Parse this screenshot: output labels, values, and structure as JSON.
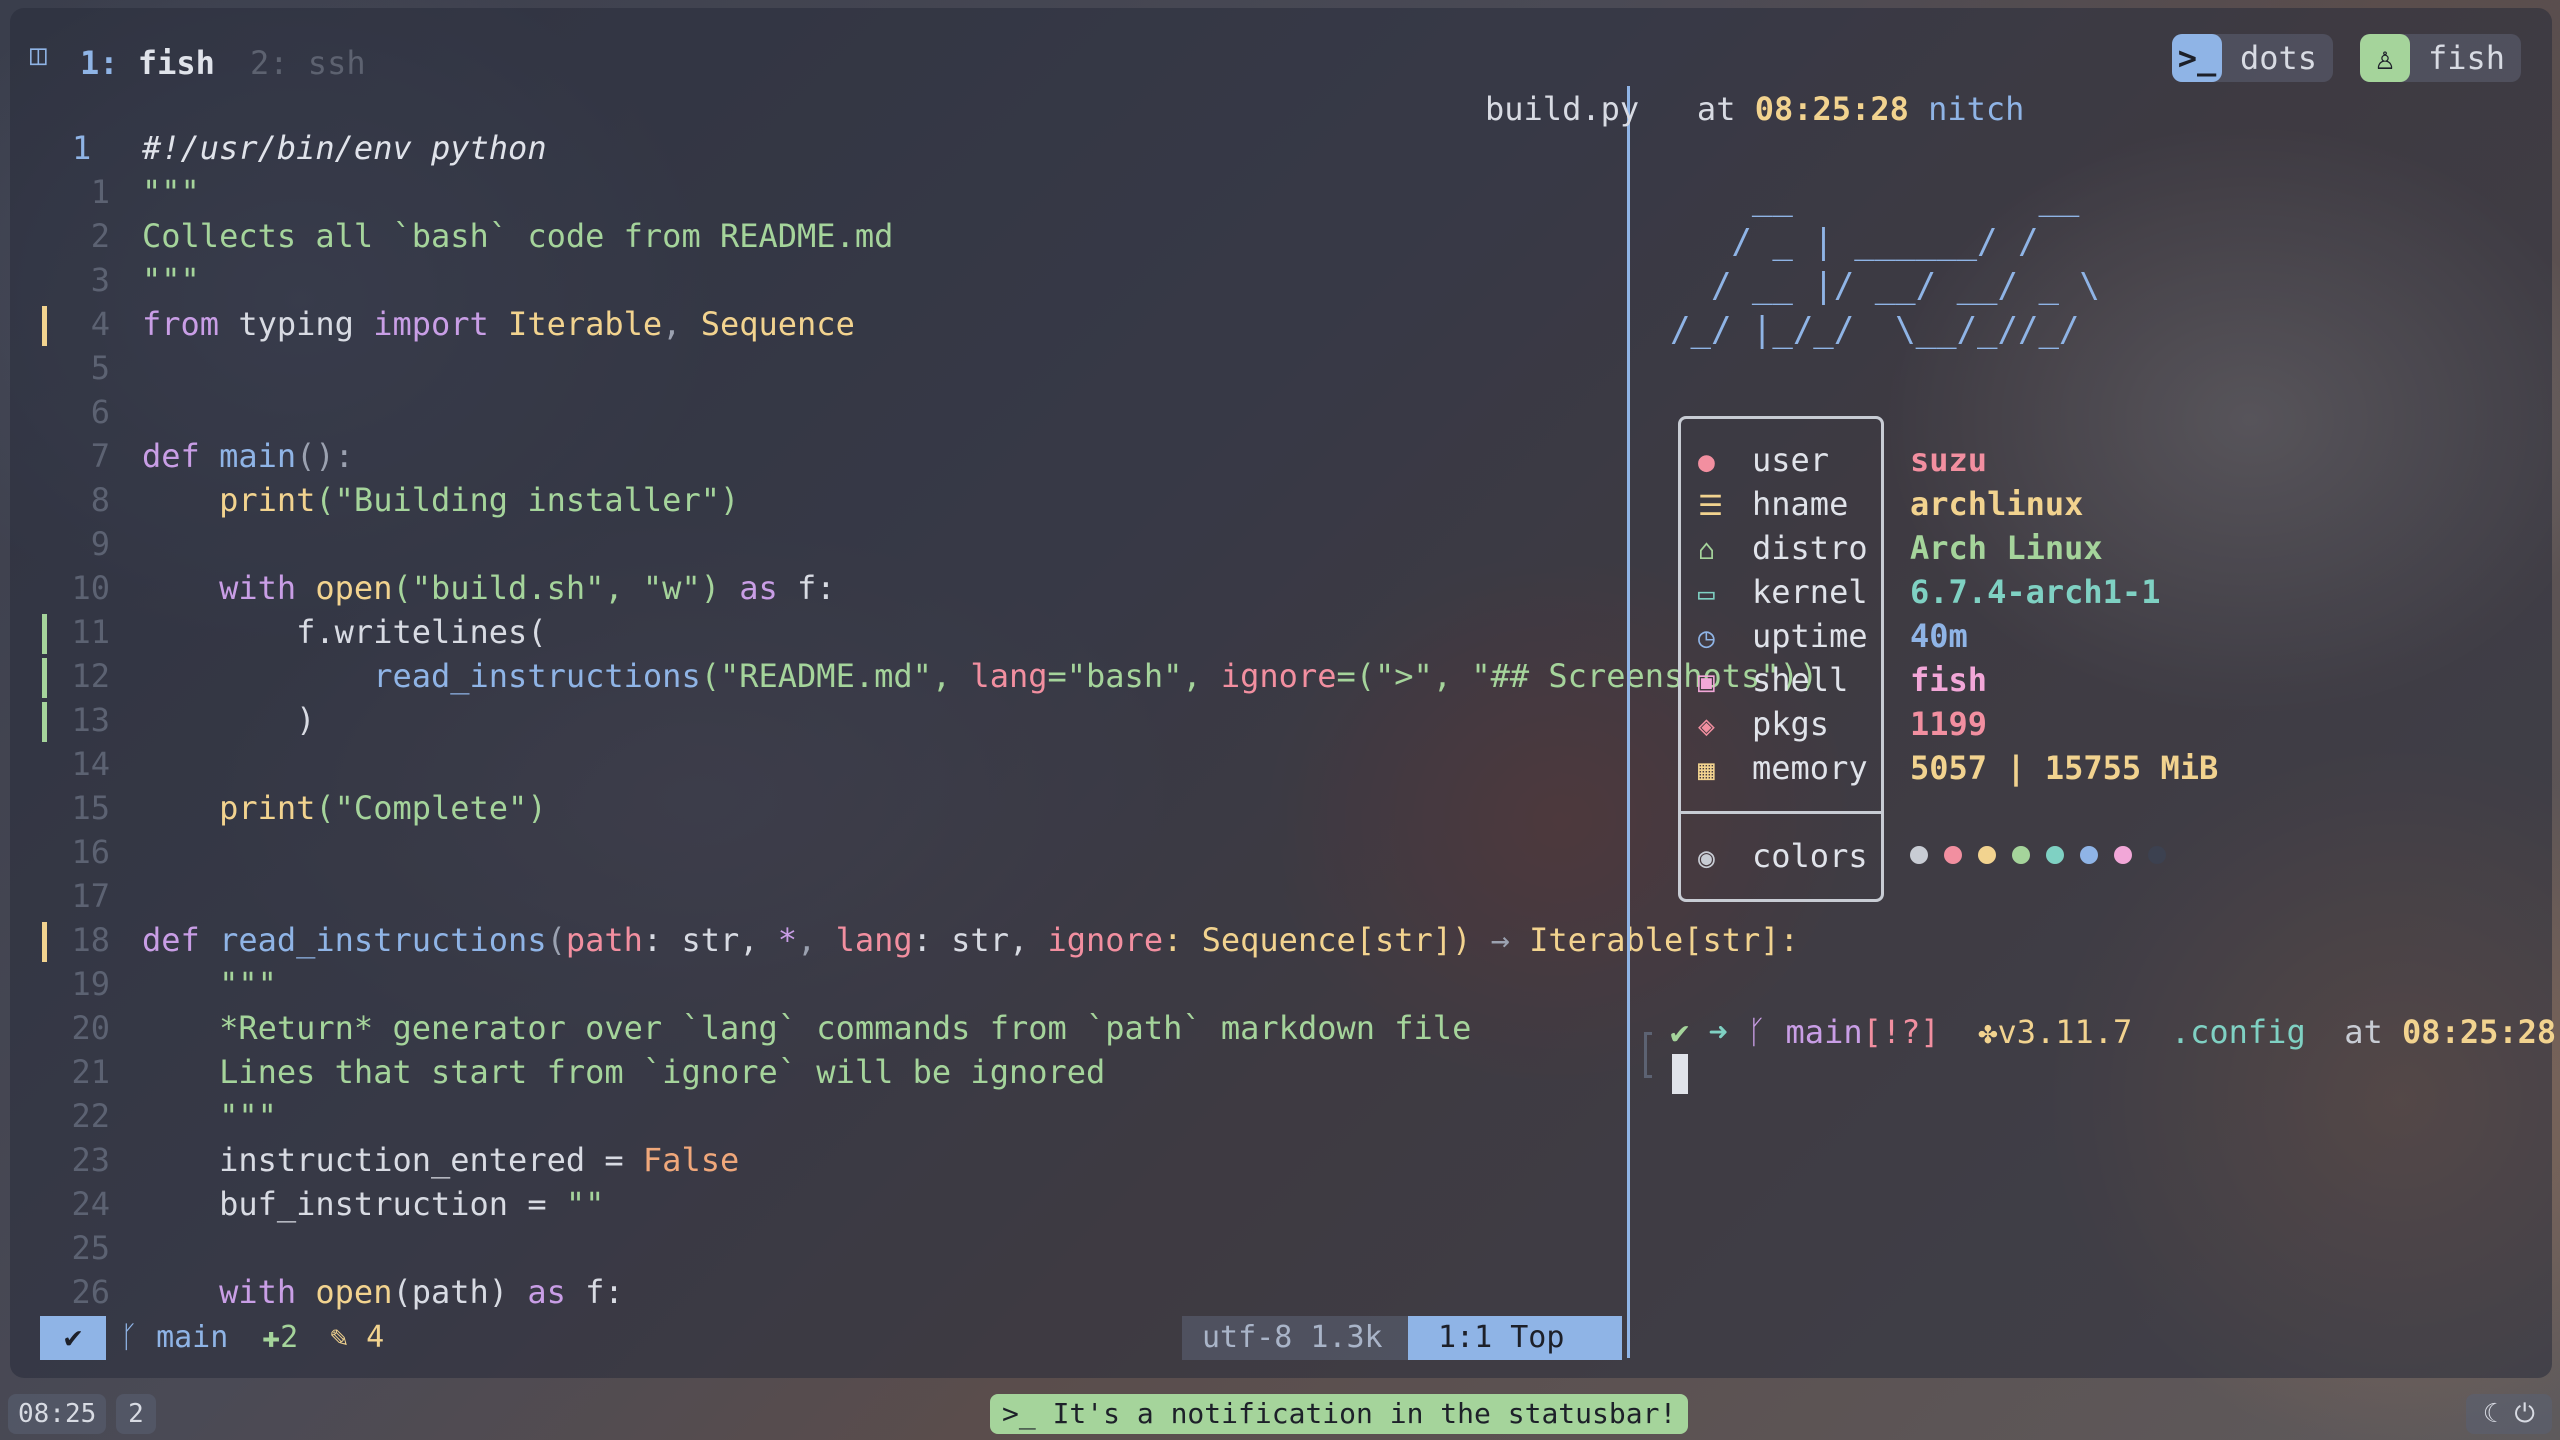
{
  "window": {
    "workspace_tabs": [
      {
        "index": "1:",
        "label": "fish"
      },
      {
        "index": "2:",
        "label": "ssh"
      }
    ],
    "right_pills": [
      {
        "label": "dots",
        "icon": "terminal-icon"
      },
      {
        "label": "fish",
        "icon": "person-icon"
      }
    ]
  },
  "editor": {
    "lines": [
      {
        "num": "1",
        "current": true
      },
      {
        "num": "1"
      },
      {
        "num": "2"
      },
      {
        "num": "3"
      },
      {
        "num": "4"
      },
      {
        "num": "5"
      },
      {
        "num": "6"
      },
      {
        "num": "7"
      },
      {
        "num": "8"
      },
      {
        "num": "9"
      },
      {
        "num": "10"
      },
      {
        "num": "11"
      },
      {
        "num": "12"
      },
      {
        "num": "13"
      },
      {
        "num": "14"
      },
      {
        "num": "15"
      },
      {
        "num": "16"
      },
      {
        "num": "17"
      },
      {
        "num": "18"
      },
      {
        "num": "19"
      },
      {
        "num": "20"
      },
      {
        "num": "21"
      },
      {
        "num": "22"
      },
      {
        "num": "23"
      },
      {
        "num": "24"
      },
      {
        "num": "25"
      },
      {
        "num": "26"
      }
    ],
    "code": {
      "l0": "#!/usr/bin/env python",
      "l1": "\"\"\"",
      "l2": "Collects all `bash` code from README.md",
      "l3": "\"\"\"",
      "l4_from": "from",
      "l4_mod": " typing ",
      "l4_import": "import",
      "l4_a": " Iterable",
      "l4_sep": ", ",
      "l4_b": "Sequence",
      "l7_def": "def",
      "l7_fn": " main",
      "l7_rest": "():",
      "l8_fn": "    print",
      "l8_str": "(\"Building installer\")",
      "l10_with": "    with",
      "l10_open": " open",
      "l10_args": "(\"build.sh\", \"w\")",
      "l10_as": " as",
      "l10_f": " f:",
      "l11": "        f.writelines(",
      "l12_fn": "            read_instructions",
      "l12_a": "(\"README.md\", ",
      "l12_k1": "lang",
      "l12_b": "=\"bash\", ",
      "l12_k2": "ignore",
      "l12_c": "=(\">\", \"## Screenshots\"))",
      "l13": "        )",
      "l15_fn": "    print",
      "l15_str": "(\"Complete\")",
      "l18_def": "def",
      "l18_fn": " read_instructions",
      "l18_p1": "(",
      "l18_path": "path",
      "l18_t1": ": str, ",
      "l18_star": "*",
      "l18_c": ", ",
      "l18_lang": "lang",
      "l18_t2": ": str, ",
      "l18_ign": "ignore",
      "l18_t3": ": Sequence[str]) ",
      "l18_arrow": "→",
      "l18_ret": " Iterable[str]:",
      "l19": "    \"\"\"",
      "l20": "    *Return* generator over `lang` commands from `path` markdown file",
      "l21": "    Lines that start from `ignore` will be ignored",
      "l22": "    \"\"\"",
      "l23_a": "    instruction_entered = ",
      "l23_b": "False",
      "l24_a": "    buf_instruction = ",
      "l24_b": "\"\"",
      "l26_with": "    with",
      "l26_open": " open",
      "l26_rest": "(path)",
      "l26_as": " as",
      "l26_f": " f:"
    },
    "status": {
      "mode": "✔",
      "branch": "main",
      "added": "2",
      "modified": "4",
      "encoding": "utf-8",
      "size": "1.3k",
      "position": "1:1",
      "scroll": "Top"
    }
  },
  "terminal": {
    "title_file": "build.py",
    "title_at": "at",
    "title_time": "08:25:28",
    "title_host": "nitch",
    "ascii_art": "    __            __\n   / _ | ______/ /\n  / __ |/ __/ __/ _ \\\n/_/ |_/_/  \\__/_//_/",
    "fetch": [
      {
        "icon": "user-icon",
        "key": "user",
        "value": "suzu",
        "color": "#f28fa0"
      },
      {
        "icon": "hostname-icon",
        "key": "hname",
        "value": "archlinux",
        "color": "#f2d38f"
      },
      {
        "icon": "distro-icon",
        "key": "distro",
        "value": "Arch Linux",
        "color": "#a5d49b"
      },
      {
        "icon": "laptop-icon",
        "key": "kernel",
        "value": "6.7.4-arch1-1",
        "color": "#7fd1c3"
      },
      {
        "icon": "clock-icon",
        "key": "uptime",
        "value": "40m",
        "color": "#8fb4e6"
      },
      {
        "icon": "terminal-icon",
        "key": "shell",
        "value": "fish",
        "color": "#f2a7d8"
      },
      {
        "icon": "package-icon",
        "key": "pkgs",
        "value": "1199",
        "color": "#f28fa0"
      },
      {
        "icon": "chip-icon",
        "key": "memory",
        "value": "5057 | 15755 MiB",
        "color": "#f2d38f"
      }
    ],
    "colors_label": "colors",
    "palette": [
      "#c8ccd4",
      "#f28fa0",
      "#f2d38f",
      "#a5d49b",
      "#7fd1c3",
      "#8fb4e6",
      "#f2a7d8",
      "#3c4150"
    ],
    "prompt": {
      "branch": "main",
      "git_status": "[!?]",
      "python": "v3.11.7",
      "dir": ".config",
      "at": "at",
      "time": "08:25:28"
    }
  },
  "sysbar": {
    "clock": "08:25",
    "workspace": "2",
    "notification": ">_ It's a notification in the statusbar!"
  }
}
